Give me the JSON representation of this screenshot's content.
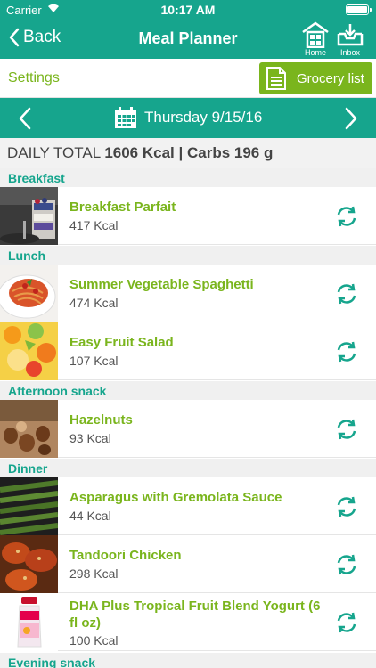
{
  "status": {
    "carrier": "Carrier",
    "time": "10:17 AM"
  },
  "nav": {
    "back_label": "Back",
    "title": "Meal Planner",
    "home_label": "Home",
    "inbox_label": "Inbox"
  },
  "toolbar": {
    "settings_label": "Settings",
    "grocery_label": "Grocery list"
  },
  "datebar": {
    "date": "Thursday 9/15/16"
  },
  "total": {
    "prefix": "DAILY TOTAL",
    "value": "1606 Kcal | Carbs 196 g"
  },
  "sections": {
    "breakfast": "Breakfast",
    "lunch": "Lunch",
    "afternoon": "Afternoon snack",
    "dinner": "Dinner",
    "evening": "Evening snack"
  },
  "meals": [
    {
      "name": "Breakfast Parfait",
      "kcal": "417 Kcal"
    },
    {
      "name": "Summer Vegetable Spaghetti",
      "kcal": "474 Kcal"
    },
    {
      "name": "Easy Fruit Salad",
      "kcal": "107 Kcal"
    },
    {
      "name": "Hazelnuts",
      "kcal": "93 Kcal"
    },
    {
      "name": "Asparagus with Gremolata Sauce",
      "kcal": "44 Kcal"
    },
    {
      "name": "Tandoori Chicken",
      "kcal": "298 Kcal"
    },
    {
      "name": "DHA Plus Tropical Fruit Blend Yogurt (6 fl oz)",
      "kcal": "100 Kcal"
    }
  ],
  "colors": {
    "teal": "#16a58d",
    "green": "#7ab51d"
  }
}
